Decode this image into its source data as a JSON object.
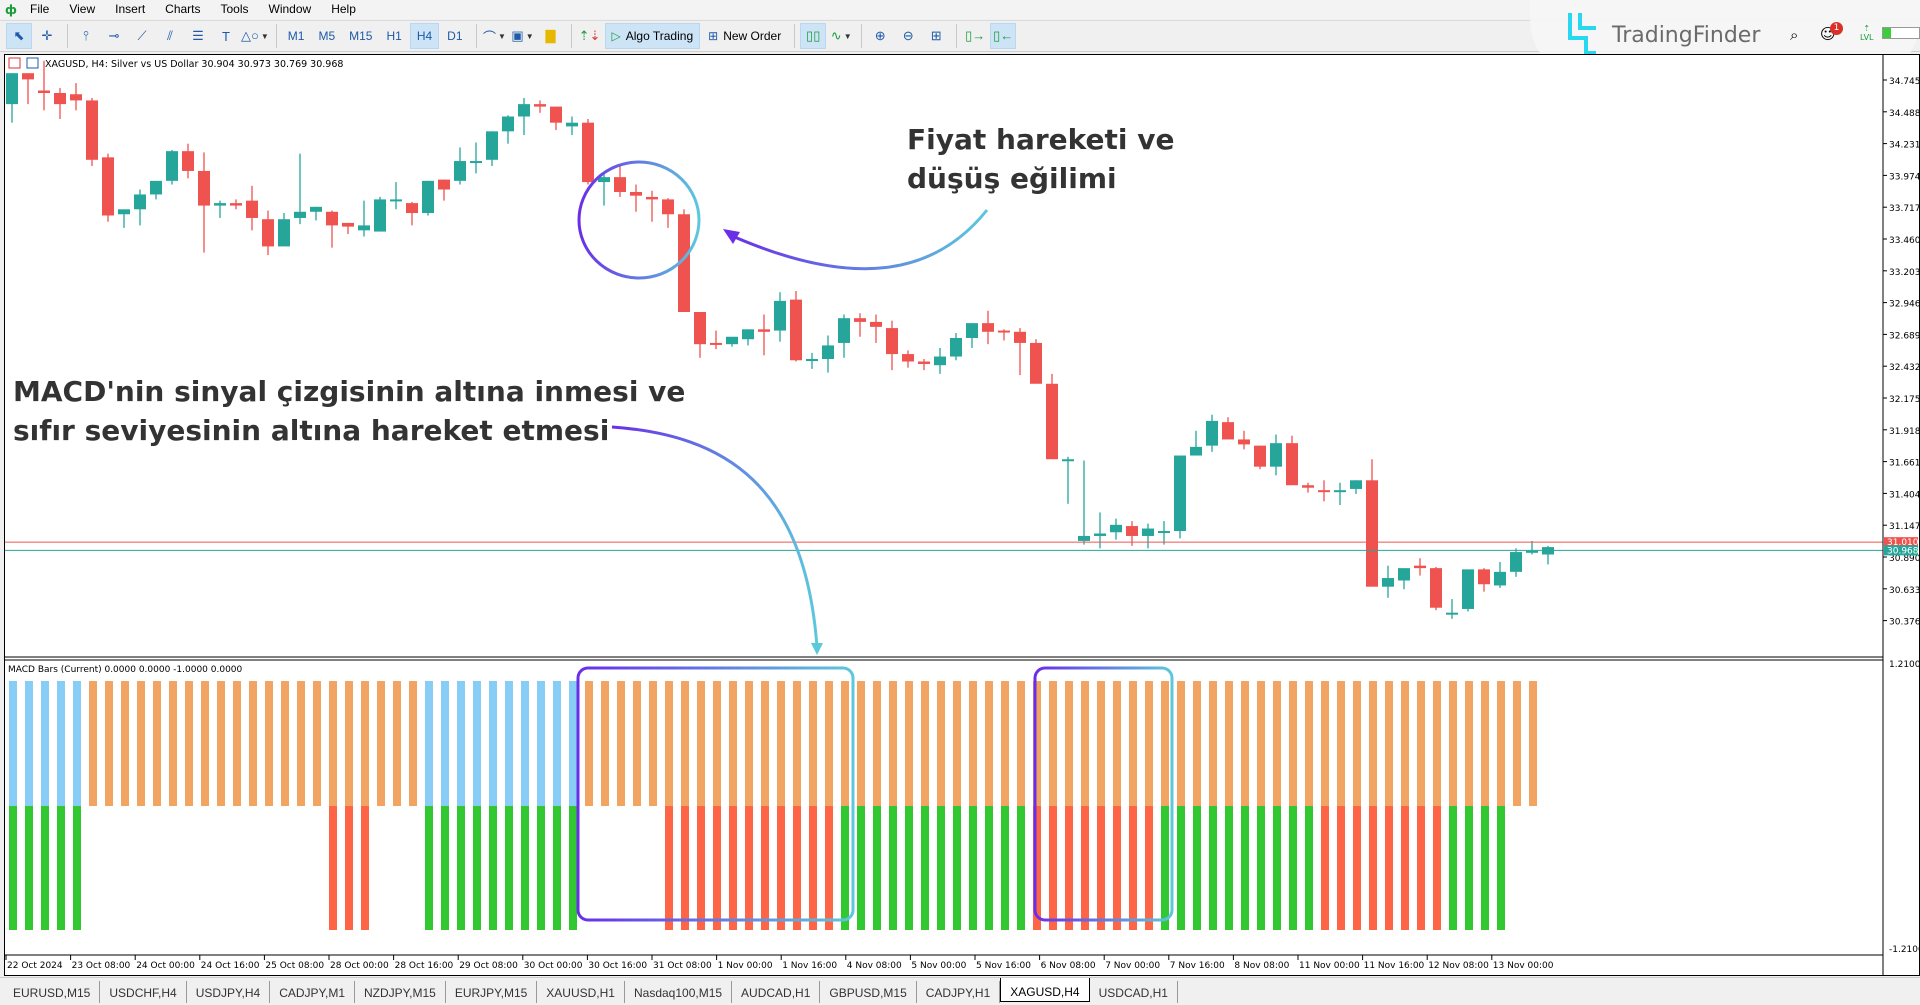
{
  "menu": {
    "items": [
      "File",
      "View",
      "Insert",
      "Charts",
      "Tools",
      "Window",
      "Help"
    ]
  },
  "toolbar": {
    "timeframes": [
      "M1",
      "M5",
      "M15",
      "H1",
      "H4",
      "D1"
    ],
    "active_timeframe": "H4",
    "algo_trading_label": "Algo Trading",
    "new_order_label": "New Order"
  },
  "branding": {
    "name": "TradingFinder",
    "notification_count": "1",
    "level_label": "LVL"
  },
  "chart": {
    "header": "XAGUSD, H4:  Silver vs US Dollar  30.904 30.973 30.769 30.968",
    "symbol": "XAGUSD",
    "timeframe": "H4",
    "description": "Silver vs US Dollar",
    "ohlc": {
      "open": "30.904",
      "high": "30.973",
      "low": "30.769",
      "close": "30.968"
    },
    "bid_label": "30.968",
    "ask_label": "31.010",
    "price_ticks": [
      "34.745",
      "34.488",
      "34.231",
      "33.974",
      "33.717",
      "33.460",
      "33.203",
      "32.946",
      "32.689",
      "32.432",
      "32.175",
      "31.918",
      "31.661",
      "31.404",
      "31.147",
      "30.890",
      "30.633",
      "30.376"
    ],
    "time_labels": [
      "22 Oct 2024",
      "23 Oct 08:00",
      "24 Oct 00:00",
      "24 Oct 16:00",
      "25 Oct 08:00",
      "28 Oct 00:00",
      "28 Oct 16:00",
      "29 Oct 08:00",
      "30 Oct 00:00",
      "30 Oct 16:00",
      "31 Oct 08:00",
      "1 Nov 00:00",
      "1 Nov 16:00",
      "4 Nov 08:00",
      "5 Nov 00:00",
      "5 Nov 16:00",
      "6 Nov 08:00",
      "7 Nov 00:00",
      "7 Nov 16:00",
      "8 Nov 08:00",
      "11 Nov 00:00",
      "11 Nov 16:00",
      "12 Nov 08:00",
      "13 Nov 00:00"
    ],
    "colors": {
      "bull": "#26a69a",
      "bear": "#ef5350",
      "bid_line": "#26a69a",
      "ask_line": "#ef5350"
    }
  },
  "indicator": {
    "header": "MACD Bars (Current) 0.0000 0.0000 -1.0000 0.0000",
    "axis_max": "1.2100",
    "axis_min": "-1.2100",
    "colors": {
      "blue": "#87cdf5",
      "orange": "#f2a462",
      "green": "#32c832",
      "red": "#fe6446"
    }
  },
  "annotations": {
    "top_right": [
      "Fiyat hareketi ve",
      "düşüş eğilimi"
    ],
    "left": [
      "MACD'nin sinyal çizgisinin altına inmesi ve",
      "sıfır seviyesinin altına hareket etmesi"
    ]
  },
  "tabs": [
    "EURUSD,M15",
    "USDCHF,H4",
    "USDJPY,H4",
    "CADJPY,M1",
    "NZDJPY,M15",
    "EURJPY,M15",
    "XAUUSD,H1",
    "Nasdaq100,M15",
    "AUDCAD,H1",
    "GBPUSD,M15",
    "CADJPY,H1",
    "XAGUSD,H4",
    "USDCAD,H1"
  ],
  "active_tab": "XAGUSD,H4",
  "chart_data": {
    "type": "candlestick",
    "title": "XAGUSD, H4: Silver vs US Dollar",
    "ylim": [
      30.25,
      34.85
    ],
    "candles": [
      [
        34.55,
        34.8,
        34.4,
        34.8
      ],
      [
        34.8,
        34.78,
        34.55,
        34.75
      ],
      [
        34.66,
        34.9,
        34.5,
        34.64
      ],
      [
        34.64,
        34.68,
        34.43,
        34.55
      ],
      [
        34.63,
        34.72,
        34.5,
        34.58
      ],
      [
        34.58,
        34.6,
        34.05,
        34.1
      ],
      [
        34.12,
        34.15,
        33.6,
        33.65
      ],
      [
        33.66,
        33.69,
        33.55,
        33.7
      ],
      [
        33.7,
        33.86,
        33.57,
        33.82
      ],
      [
        33.82,
        33.91,
        33.78,
        33.93
      ],
      [
        33.93,
        34.18,
        33.9,
        34.17
      ],
      [
        34.17,
        34.23,
        33.95,
        34.01
      ],
      [
        34.01,
        34.16,
        33.35,
        33.73
      ],
      [
        33.73,
        33.77,
        33.63,
        33.75
      ],
      [
        33.75,
        33.78,
        33.7,
        33.73
      ],
      [
        33.77,
        33.89,
        33.53,
        33.63
      ],
      [
        33.62,
        33.69,
        33.33,
        33.4
      ],
      [
        33.4,
        33.67,
        33.44,
        33.62
      ],
      [
        33.63,
        34.15,
        33.58,
        33.68
      ],
      [
        33.68,
        33.72,
        33.61,
        33.72
      ],
      [
        33.68,
        33.69,
        33.39,
        33.57
      ],
      [
        33.59,
        33.59,
        33.5,
        33.56
      ],
      [
        33.53,
        33.77,
        33.48,
        33.57
      ],
      [
        33.52,
        33.8,
        33.56,
        33.78
      ],
      [
        33.78,
        33.92,
        33.7,
        33.78
      ],
      [
        33.75,
        33.76,
        33.57,
        33.67
      ],
      [
        33.67,
        33.93,
        33.65,
        33.93
      ],
      [
        33.94,
        33.94,
        33.77,
        33.86
      ],
      [
        33.93,
        34.2,
        33.9,
        34.09
      ],
      [
        34.09,
        34.24,
        33.99,
        34.09
      ],
      [
        34.1,
        34.33,
        34.05,
        34.33
      ],
      [
        34.33,
        34.46,
        34.23,
        34.45
      ],
      [
        34.45,
        34.6,
        34.3,
        34.55
      ],
      [
        34.55,
        34.58,
        34.48,
        34.53
      ],
      [
        34.53,
        34.51,
        34.34,
        34.4
      ],
      [
        34.37,
        34.45,
        34.3,
        34.4
      ],
      [
        34.4,
        34.43,
        33.9,
        33.92
      ],
      [
        33.92,
        34.0,
        33.73,
        33.96
      ],
      [
        33.96,
        34.05,
        33.8,
        33.84
      ],
      [
        33.84,
        33.9,
        33.68,
        33.81
      ],
      [
        33.8,
        33.85,
        33.6,
        33.78
      ],
      [
        33.78,
        33.79,
        33.55,
        33.66
      ],
      [
        33.66,
        33.7,
        32.87,
        32.87
      ],
      [
        32.87,
        32.87,
        32.5,
        32.61
      ],
      [
        32.62,
        32.72,
        32.57,
        32.61
      ],
      [
        32.61,
        32.66,
        32.59,
        32.67
      ],
      [
        32.65,
        32.73,
        32.6,
        32.73
      ],
      [
        32.73,
        32.85,
        32.52,
        32.71
      ],
      [
        32.72,
        33.03,
        32.63,
        32.96
      ],
      [
        32.97,
        33.04,
        32.47,
        32.48
      ],
      [
        32.48,
        32.54,
        32.41,
        32.49
      ],
      [
        32.49,
        32.68,
        32.38,
        32.6
      ],
      [
        32.62,
        32.85,
        32.5,
        32.82
      ],
      [
        32.82,
        32.86,
        32.67,
        32.79
      ],
      [
        32.79,
        32.85,
        32.62,
        32.75
      ],
      [
        32.74,
        32.8,
        32.4,
        32.53
      ],
      [
        32.53,
        32.56,
        32.42,
        32.47
      ],
      [
        32.47,
        32.49,
        32.4,
        32.45
      ],
      [
        32.44,
        32.58,
        32.37,
        32.51
      ],
      [
        32.51,
        32.7,
        32.48,
        32.66
      ],
      [
        32.66,
        32.76,
        32.58,
        32.78
      ],
      [
        32.78,
        32.88,
        32.61,
        32.71
      ],
      [
        32.72,
        32.73,
        32.64,
        32.71
      ],
      [
        32.71,
        32.74,
        32.36,
        32.62
      ],
      [
        32.62,
        32.65,
        32.32,
        32.29
      ],
      [
        32.29,
        32.37,
        31.8,
        31.68
      ],
      [
        31.68,
        31.7,
        31.32,
        31.68
      ],
      [
        31.02,
        31.67,
        30.99,
        31.06
      ],
      [
        31.06,
        31.25,
        30.96,
        31.08
      ],
      [
        31.09,
        31.2,
        31.03,
        31.15
      ],
      [
        31.14,
        31.18,
        30.98,
        31.06
      ],
      [
        31.06,
        31.16,
        30.96,
        31.12
      ],
      [
        31.09,
        31.18,
        30.99,
        31.1
      ],
      [
        31.1,
        31.63,
        31.04,
        31.71
      ],
      [
        31.71,
        31.91,
        31.71,
        31.78
      ],
      [
        31.79,
        32.04,
        31.74,
        31.99
      ],
      [
        31.98,
        32.02,
        31.85,
        31.84
      ],
      [
        31.84,
        31.91,
        31.76,
        31.8
      ],
      [
        31.79,
        31.79,
        31.6,
        31.62
      ],
      [
        31.62,
        31.88,
        31.55,
        31.81
      ],
      [
        31.81,
        31.87,
        31.55,
        31.47
      ],
      [
        31.47,
        31.49,
        31.41,
        31.45
      ],
      [
        31.43,
        31.51,
        31.34,
        31.42
      ],
      [
        31.42,
        31.49,
        31.31,
        31.43
      ],
      [
        31.44,
        31.51,
        31.4,
        31.51
      ],
      [
        31.51,
        31.68,
        30.83,
        30.65
      ],
      [
        30.65,
        30.82,
        30.56,
        30.72
      ],
      [
        30.7,
        30.78,
        30.63,
        30.8
      ],
      [
        30.82,
        30.88,
        30.74,
        30.8
      ],
      [
        30.8,
        30.81,
        30.46,
        30.48
      ],
      [
        30.44,
        30.55,
        30.39,
        30.44
      ],
      [
        30.47,
        30.78,
        30.45,
        30.79
      ],
      [
        30.79,
        30.8,
        30.61,
        30.67
      ],
      [
        30.66,
        30.85,
        30.64,
        30.77
      ],
      [
        30.77,
        30.96,
        30.73,
        30.93
      ],
      [
        30.93,
        31.02,
        30.91,
        30.94
      ],
      [
        30.91,
        30.98,
        30.83,
        30.97
      ]
    ],
    "macd_bars": {
      "legend": "signal state (upper half) / zero-line state (lower half)",
      "upper": [
        "B",
        "B",
        "B",
        "B",
        "B",
        "O",
        "O",
        "O",
        "O",
        "O",
        "O",
        "O",
        "O",
        "O",
        "O",
        "O",
        "O",
        "O",
        "O",
        "O",
        "O",
        "O",
        "O",
        "O",
        "O",
        "O",
        "B",
        "B",
        "B",
        "B",
        "B",
        "B",
        "B",
        "B",
        "B",
        "B",
        "O",
        "O",
        "O",
        "O",
        "O",
        "O",
        "O",
        "O",
        "O",
        "O",
        "O",
        "O",
        "O",
        "O",
        "O",
        "O",
        "O",
        "O",
        "O",
        "O",
        "O",
        "O",
        "O",
        "O",
        "O",
        "O",
        "O",
        "O",
        "O",
        "O",
        "O",
        "O",
        "O",
        "O",
        "O",
        "O",
        "O",
        "O",
        "O",
        "O",
        "O",
        "O",
        "O",
        "O",
        "O",
        "O",
        "O",
        "O",
        "O",
        "O",
        "O",
        "O",
        "O",
        "O",
        "O",
        "O",
        "O",
        "O",
        "O",
        "O"
      ],
      "lower": [
        "G",
        "G",
        "G",
        "G",
        "G",
        "N",
        "N",
        "N",
        "N",
        "N",
        "N",
        "N",
        "N",
        "N",
        "N",
        "N",
        "N",
        "N",
        "N",
        "N",
        "R",
        "R",
        "R",
        "N",
        "N",
        "N",
        "G",
        "G",
        "G",
        "G",
        "G",
        "G",
        "G",
        "G",
        "G",
        "G",
        "N",
        "N",
        "N",
        "N",
        "N",
        "R",
        "R",
        "R",
        "R",
        "R",
        "R",
        "R",
        "R",
        "R",
        "R",
        "R",
        "G",
        "G",
        "G",
        "G",
        "G",
        "G",
        "G",
        "G",
        "G",
        "G",
        "G",
        "G",
        "R",
        "R",
        "R",
        "R",
        "R",
        "R",
        "R",
        "R",
        "G",
        "G",
        "G",
        "G",
        "G",
        "G",
        "G",
        "G",
        "G",
        "G",
        "R",
        "R",
        "R",
        "R",
        "R",
        "R",
        "R",
        "R",
        "G",
        "G",
        "G",
        "G"
      ]
    }
  }
}
